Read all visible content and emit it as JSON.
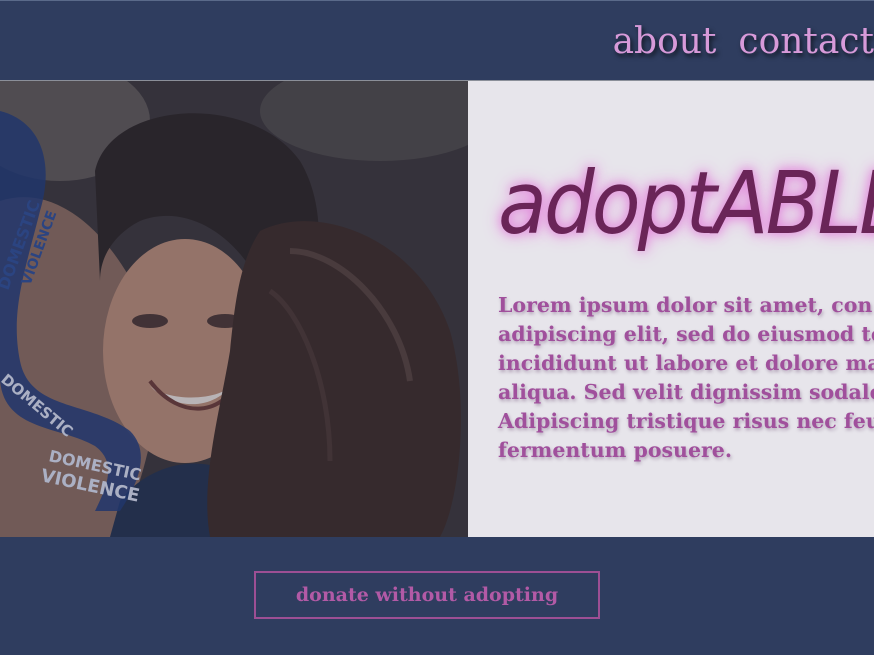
{
  "nav": {
    "items": [
      {
        "label": "about"
      },
      {
        "label": "contact"
      }
    ]
  },
  "hero": {
    "brand": "adoptABLE",
    "body_lines": [
      "Lorem ipsum dolor sit amet, con",
      "adipiscing elit, sed do eiusmod te",
      "incididunt ut labore et dolore ma",
      "aliqua. Sed velit dignissim sodale",
      "Adipiscing tristique risus nec feu",
      "fermentum posuere."
    ]
  },
  "footer": {
    "donate_label": "donate without adopting"
  },
  "colors": {
    "background": "#2f3d5f",
    "nav_text": "#d79ad9",
    "brand": "#6a2558",
    "body_text": "#a0509c",
    "panel": "#e7e5eb",
    "button_border": "#9d4f94"
  }
}
